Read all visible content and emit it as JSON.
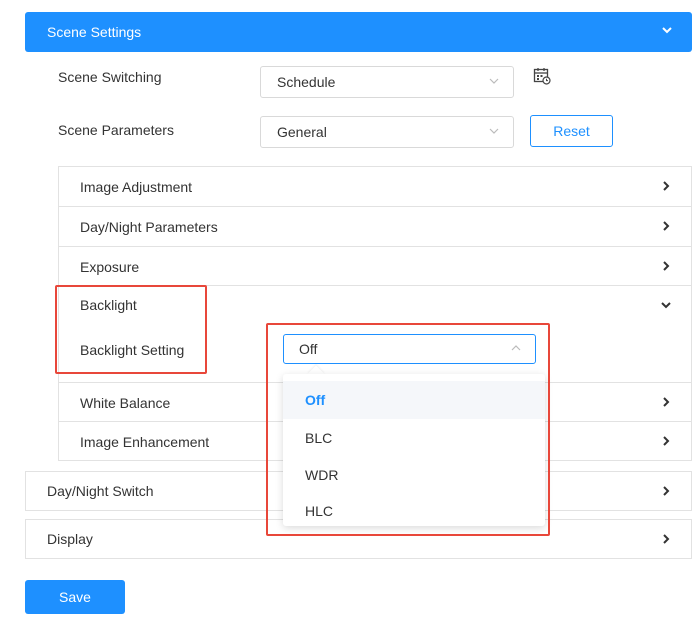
{
  "scene_settings": {
    "title": "Scene Settings",
    "scene_switching": {
      "label": "Scene Switching",
      "value": "Schedule"
    },
    "scene_parameters": {
      "label": "Scene Parameters",
      "value": "General",
      "reset_label": "Reset"
    }
  },
  "inner_sections": {
    "image_adjustment": "Image Adjustment",
    "day_night_parameters": "Day/Night Parameters",
    "exposure": "Exposure",
    "backlight": {
      "label": "Backlight",
      "setting_label": "Backlight Setting",
      "setting_value": "Off",
      "options": [
        "Off",
        "BLC",
        "WDR",
        "HLC"
      ],
      "selected_option": "Off"
    },
    "white_balance": "White Balance",
    "image_enhancement": "Image Enhancement"
  },
  "outer_sections": {
    "day_night_switch": "Day/Night Switch",
    "display": "Display"
  },
  "save_label": "Save",
  "colors": {
    "accent": "#1e90ff",
    "annotation": "#e8473a",
    "border": "#e2e2e2"
  }
}
